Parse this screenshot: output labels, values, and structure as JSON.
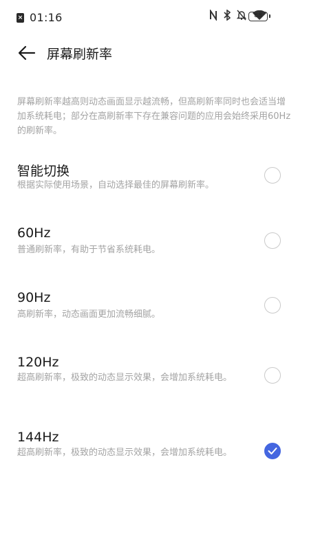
{
  "status_bar": {
    "time": "01:16",
    "sim_icon": "sim-missing-icon",
    "icons": [
      "nfc-icon",
      "bluetooth-icon",
      "bell-muted-icon",
      "wifi-icon"
    ],
    "battery": "88"
  },
  "header": {
    "back_icon": "arrow-left-icon",
    "title": "屏幕刷新率"
  },
  "description": "屏幕刷新率越高则动态画面显示越流畅，但高刷新率同时也会适当增加系统耗电；部分在高刷新率下存在兼容问题的应用会始终采用60Hz的刷新率。",
  "options": [
    {
      "label": "智能切换",
      "sublabel": "根据实际使用场景，自动选择最佳的屏幕刷新率。",
      "selected": false
    },
    {
      "label": "60Hz",
      "sublabel": "普通刷新率，有助于节省系统耗电。",
      "selected": false
    },
    {
      "label": "90Hz",
      "sublabel": "高刷新率，动态画面更加流畅细腻。",
      "selected": false
    },
    {
      "label": "120Hz",
      "sublabel": "超高刷新率，极致的动态显示效果，会增加系统耗电。",
      "selected": false
    },
    {
      "label": "144Hz",
      "sublabel": "超高刷新率，极致的动态显示效果，会增加系统耗电。",
      "selected": true
    }
  ],
  "colors": {
    "accent": "#4466e0",
    "secondary_text": "#a3a3a3"
  }
}
